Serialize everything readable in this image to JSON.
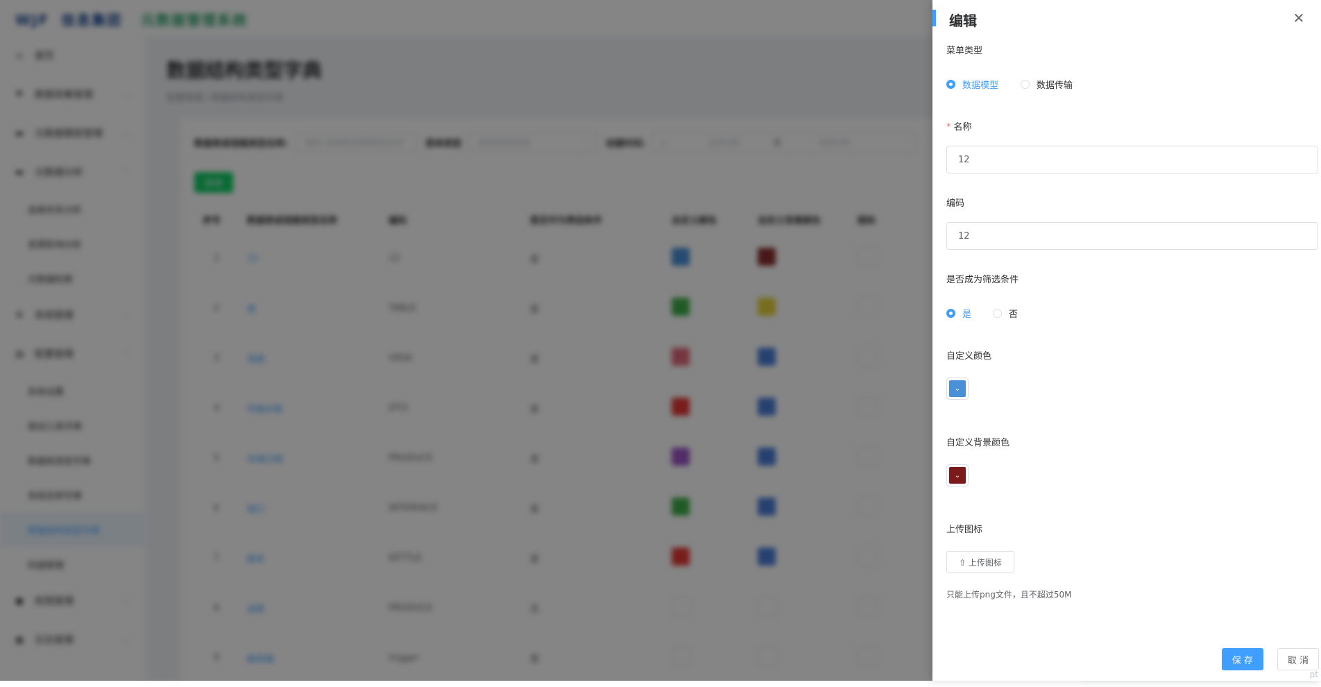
{
  "header": {
    "logo": "WJF",
    "company": "信息集团",
    "system": "元数据管理系统"
  },
  "sidebar": {
    "items": [
      {
        "label": "首页",
        "icon": "home-icon",
        "glyph": "⌂"
      },
      {
        "label": "数据采集管理",
        "icon": "flag-icon",
        "glyph": "⚑",
        "arrow": true
      },
      {
        "label": "元数据模型管理",
        "icon": "monitor-icon",
        "glyph": "▬",
        "arrow": true
      },
      {
        "label": "元数据分析",
        "icon": "monitor-icon",
        "glyph": "▬",
        "arrow": true,
        "open": true
      }
    ],
    "analysis_sub": [
      "血缘关系分析",
      "变更影响分析",
      "元数据检索"
    ],
    "system": {
      "label": "系统管理",
      "icon": "gear-icon",
      "glyph": "⚙"
    },
    "config": {
      "label": "配置管理",
      "icon": "list-icon",
      "glyph": "▤"
    },
    "config_sub": [
      "系统设置",
      "驱动工具字典",
      "数据库类型字典",
      "系统名称字典",
      "数据结构类型字典",
      "码值管理"
    ],
    "active_sub": "数据结构类型字典",
    "perm": {
      "label": "权限管理",
      "icon": "user-icon",
      "glyph": "👤"
    },
    "log": {
      "label": "日志管理",
      "icon": "log-icon",
      "glyph": "▣"
    }
  },
  "page": {
    "title": "数据结构类型字典",
    "breadcrumb": "配置管理 / 数据结构类型字典"
  },
  "filters": {
    "name_label": "数据表或视图类型名称:",
    "name_placeholder": "请输入数据表或视图类型名称",
    "menu_label": "菜单类型",
    "menu_placeholder": "请选择菜单类型",
    "time_label": "创建时间:",
    "start_placeholder": "选择日期",
    "range_sep": "至",
    "end_placeholder": "选择日期"
  },
  "add_button": "新增",
  "table": {
    "headers": [
      "序号",
      "数据表或视图类型名称",
      "编码",
      "是否作为筛选条件",
      "自定义颜色",
      "自定义背景颜色",
      "图标"
    ],
    "rows": [
      {
        "idx": "1",
        "name": "12",
        "code": "12",
        "filter": "是",
        "color": "#4a90d9",
        "bg": "#8b2e2e",
        "icon": "broken"
      },
      {
        "idx": "2",
        "name": "表",
        "code": "TABLE",
        "filter": "是",
        "color": "#3fae4a",
        "bg": "#e6d23a",
        "icon": "box"
      },
      {
        "idx": "3",
        "name": "视图",
        "code": "VIEW",
        "filter": "是",
        "color": "#e06a7a",
        "bg": "#4a7ed9",
        "icon": "box"
      },
      {
        "idx": "4",
        "name": "传输对象",
        "code": "DTO",
        "filter": "是",
        "color": "#e53935",
        "bg": "#4a7ed9",
        "icon": "box"
      },
      {
        "idx": "5",
        "name": "存储过程",
        "code": "PRODUCE",
        "filter": "是",
        "color": "#9c56c9",
        "bg": "#4a7ed9",
        "icon": "box"
      },
      {
        "idx": "6",
        "name": "接口",
        "code": "INTERFACE",
        "filter": "是",
        "color": "#3fae4a",
        "bg": "#4a7ed9",
        "icon": "box"
      },
      {
        "idx": "7",
        "name": "脚本",
        "code": "KETTLE",
        "filter": "是",
        "color": "#e53935",
        "bg": "#4a7ed9",
        "icon": "box"
      },
      {
        "idx": "8",
        "name": "函数",
        "code": "PRODUCE",
        "filter": "否",
        "color": "",
        "bg": "",
        "icon": "broken"
      },
      {
        "idx": "9",
        "name": "触发器",
        "code": "trigger",
        "filter": "是",
        "color": "",
        "bg": "",
        "icon": "broken"
      }
    ]
  },
  "drawer": {
    "title": "编辑",
    "close_icon": "close-icon",
    "menu_type_label": "菜单类型",
    "menu_type_options": [
      "数据模型",
      "数据传输"
    ],
    "menu_type_selected": "数据模型",
    "name_label": "名称",
    "name_required_mark": "*",
    "name_value": "12",
    "code_label": "编码",
    "code_value": "12",
    "filter_label": "是否成为筛选条件",
    "filter_options": [
      "是",
      "否"
    ],
    "filter_selected": "是",
    "color_label": "自定义颜色",
    "color_value": "#4a90d9",
    "bg_label": "自定义背景颜色",
    "bg_value": "#7a1a1a",
    "picker_glyph": "⌄",
    "upload_label": "上传图标",
    "upload_button": "⇧ 上传图标",
    "upload_tip": "只能上传png文件，且不超过50M",
    "save_button": "保 存",
    "cancel_button": "取 消"
  },
  "watermark": "pt"
}
